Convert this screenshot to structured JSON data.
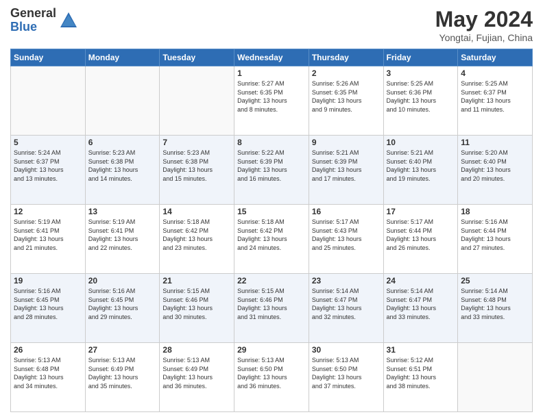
{
  "header": {
    "logo_general": "General",
    "logo_blue": "Blue",
    "month_year": "May 2024",
    "location": "Yongtai, Fujian, China"
  },
  "weekdays": [
    "Sunday",
    "Monday",
    "Tuesday",
    "Wednesday",
    "Thursday",
    "Friday",
    "Saturday"
  ],
  "weeks": [
    [
      {
        "day": "",
        "info": ""
      },
      {
        "day": "",
        "info": ""
      },
      {
        "day": "",
        "info": ""
      },
      {
        "day": "1",
        "info": "Sunrise: 5:27 AM\nSunset: 6:35 PM\nDaylight: 13 hours\nand 8 minutes."
      },
      {
        "day": "2",
        "info": "Sunrise: 5:26 AM\nSunset: 6:35 PM\nDaylight: 13 hours\nand 9 minutes."
      },
      {
        "day": "3",
        "info": "Sunrise: 5:25 AM\nSunset: 6:36 PM\nDaylight: 13 hours\nand 10 minutes."
      },
      {
        "day": "4",
        "info": "Sunrise: 5:25 AM\nSunset: 6:37 PM\nDaylight: 13 hours\nand 11 minutes."
      }
    ],
    [
      {
        "day": "5",
        "info": "Sunrise: 5:24 AM\nSunset: 6:37 PM\nDaylight: 13 hours\nand 13 minutes."
      },
      {
        "day": "6",
        "info": "Sunrise: 5:23 AM\nSunset: 6:38 PM\nDaylight: 13 hours\nand 14 minutes."
      },
      {
        "day": "7",
        "info": "Sunrise: 5:23 AM\nSunset: 6:38 PM\nDaylight: 13 hours\nand 15 minutes."
      },
      {
        "day": "8",
        "info": "Sunrise: 5:22 AM\nSunset: 6:39 PM\nDaylight: 13 hours\nand 16 minutes."
      },
      {
        "day": "9",
        "info": "Sunrise: 5:21 AM\nSunset: 6:39 PM\nDaylight: 13 hours\nand 17 minutes."
      },
      {
        "day": "10",
        "info": "Sunrise: 5:21 AM\nSunset: 6:40 PM\nDaylight: 13 hours\nand 19 minutes."
      },
      {
        "day": "11",
        "info": "Sunrise: 5:20 AM\nSunset: 6:40 PM\nDaylight: 13 hours\nand 20 minutes."
      }
    ],
    [
      {
        "day": "12",
        "info": "Sunrise: 5:19 AM\nSunset: 6:41 PM\nDaylight: 13 hours\nand 21 minutes."
      },
      {
        "day": "13",
        "info": "Sunrise: 5:19 AM\nSunset: 6:41 PM\nDaylight: 13 hours\nand 22 minutes."
      },
      {
        "day": "14",
        "info": "Sunrise: 5:18 AM\nSunset: 6:42 PM\nDaylight: 13 hours\nand 23 minutes."
      },
      {
        "day": "15",
        "info": "Sunrise: 5:18 AM\nSunset: 6:42 PM\nDaylight: 13 hours\nand 24 minutes."
      },
      {
        "day": "16",
        "info": "Sunrise: 5:17 AM\nSunset: 6:43 PM\nDaylight: 13 hours\nand 25 minutes."
      },
      {
        "day": "17",
        "info": "Sunrise: 5:17 AM\nSunset: 6:44 PM\nDaylight: 13 hours\nand 26 minutes."
      },
      {
        "day": "18",
        "info": "Sunrise: 5:16 AM\nSunset: 6:44 PM\nDaylight: 13 hours\nand 27 minutes."
      }
    ],
    [
      {
        "day": "19",
        "info": "Sunrise: 5:16 AM\nSunset: 6:45 PM\nDaylight: 13 hours\nand 28 minutes."
      },
      {
        "day": "20",
        "info": "Sunrise: 5:16 AM\nSunset: 6:45 PM\nDaylight: 13 hours\nand 29 minutes."
      },
      {
        "day": "21",
        "info": "Sunrise: 5:15 AM\nSunset: 6:46 PM\nDaylight: 13 hours\nand 30 minutes."
      },
      {
        "day": "22",
        "info": "Sunrise: 5:15 AM\nSunset: 6:46 PM\nDaylight: 13 hours\nand 31 minutes."
      },
      {
        "day": "23",
        "info": "Sunrise: 5:14 AM\nSunset: 6:47 PM\nDaylight: 13 hours\nand 32 minutes."
      },
      {
        "day": "24",
        "info": "Sunrise: 5:14 AM\nSunset: 6:47 PM\nDaylight: 13 hours\nand 33 minutes."
      },
      {
        "day": "25",
        "info": "Sunrise: 5:14 AM\nSunset: 6:48 PM\nDaylight: 13 hours\nand 33 minutes."
      }
    ],
    [
      {
        "day": "26",
        "info": "Sunrise: 5:13 AM\nSunset: 6:48 PM\nDaylight: 13 hours\nand 34 minutes."
      },
      {
        "day": "27",
        "info": "Sunrise: 5:13 AM\nSunset: 6:49 PM\nDaylight: 13 hours\nand 35 minutes."
      },
      {
        "day": "28",
        "info": "Sunrise: 5:13 AM\nSunset: 6:49 PM\nDaylight: 13 hours\nand 36 minutes."
      },
      {
        "day": "29",
        "info": "Sunrise: 5:13 AM\nSunset: 6:50 PM\nDaylight: 13 hours\nand 36 minutes."
      },
      {
        "day": "30",
        "info": "Sunrise: 5:13 AM\nSunset: 6:50 PM\nDaylight: 13 hours\nand 37 minutes."
      },
      {
        "day": "31",
        "info": "Sunrise: 5:12 AM\nSunset: 6:51 PM\nDaylight: 13 hours\nand 38 minutes."
      },
      {
        "day": "",
        "info": ""
      }
    ]
  ]
}
